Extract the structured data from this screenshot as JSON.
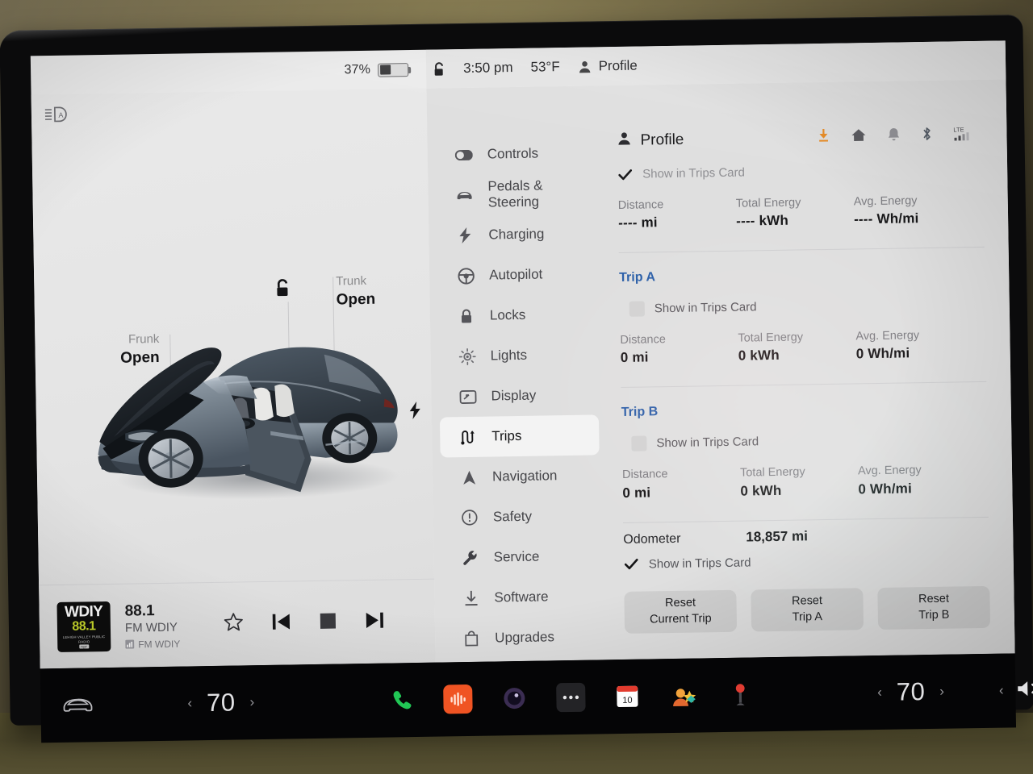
{
  "status_bar": {
    "battery_percent": "37%",
    "battery_level": 37,
    "lock_icon": "unlocked-padlock-icon",
    "time": "3:50 pm",
    "temperature": "53°F",
    "profile_label": "Profile"
  },
  "car_view": {
    "auto_headlight_icon": "auto-headlight-icon",
    "frunk": {
      "label": "Frunk",
      "state": "Open"
    },
    "trunk": {
      "label": "Trunk",
      "state": "Open"
    },
    "lock_icon": "unlocked-padlock-icon",
    "charge_port_icon": "charge-bolt-icon"
  },
  "media_player": {
    "art_primary": "WDIY",
    "art_secondary": "88.1",
    "art_tagline": "LEHIGH VALLEY PUBLIC RADIO",
    "art_badge": "npr",
    "frequency": "88.1",
    "station": "FM WDIY",
    "source": "FM WDIY",
    "controls": {
      "favorite": "star-icon",
      "previous": "previous-track-icon",
      "stop": "stop-icon",
      "next": "next-track-icon"
    }
  },
  "settings_menu": {
    "items": [
      {
        "label": "Controls",
        "icon": "toggle-switch-icon",
        "active": false
      },
      {
        "label": "Pedals & Steering",
        "icon": "car-front-icon",
        "active": false
      },
      {
        "label": "Charging",
        "icon": "lightning-bolt-icon",
        "active": false
      },
      {
        "label": "Autopilot",
        "icon": "steering-wheel-icon",
        "active": false
      },
      {
        "label": "Locks",
        "icon": "padlock-icon",
        "active": false
      },
      {
        "label": "Lights",
        "icon": "light-bulb-icon",
        "active": false
      },
      {
        "label": "Display",
        "icon": "display-icon",
        "active": false
      },
      {
        "label": "Trips",
        "icon": "route-icon",
        "active": true
      },
      {
        "label": "Navigation",
        "icon": "navigation-arrow-icon",
        "active": false
      },
      {
        "label": "Safety",
        "icon": "alert-circle-icon",
        "active": false
      },
      {
        "label": "Service",
        "icon": "wrench-icon",
        "active": false
      },
      {
        "label": "Software",
        "icon": "download-icon",
        "active": false
      },
      {
        "label": "Upgrades",
        "icon": "shopping-bag-icon",
        "active": false
      }
    ]
  },
  "trips_panel": {
    "header": {
      "title": "Profile",
      "icon": "person-icon"
    },
    "status_icons": [
      "download-icon",
      "home-icon",
      "bell-icon",
      "bluetooth-icon",
      "lte-signal-icon"
    ],
    "lte_label": "LTE",
    "notification_download_icon": "download-arrow-icon",
    "checkbox_label": "Show in Trips Card",
    "stat_labels": {
      "distance": "Distance",
      "total_energy": "Total Energy",
      "avg_energy": "Avg. Energy"
    },
    "units": {
      "distance": "mi",
      "total_energy": "kWh",
      "avg_energy": "Wh/mi"
    },
    "current_trip": {
      "show_in_trips_card": true,
      "checkbox_enabled": false,
      "distance": "----",
      "total_energy": "----",
      "avg_energy": "----"
    },
    "trip_a": {
      "title": "Trip A",
      "show_in_trips_card": false,
      "distance": "0",
      "total_energy": "0",
      "avg_energy": "0"
    },
    "trip_b": {
      "title": "Trip B",
      "show_in_trips_card": false,
      "distance": "0",
      "total_energy": "0",
      "avg_energy": "0"
    },
    "odometer": {
      "label": "Odometer",
      "value": "18,857",
      "unit": "mi",
      "show_in_trips_card": true
    },
    "buttons": [
      {
        "line1": "Reset",
        "line2": "Current Trip"
      },
      {
        "line1": "Reset",
        "line2": "Trip A"
      },
      {
        "line1": "Reset",
        "line2": "Trip B"
      }
    ]
  },
  "app_bar": {
    "car_icon": "car-icon",
    "driver_temp": "70",
    "passenger_temp": "70",
    "apps": [
      {
        "name": "phone-icon",
        "color": "#21c755"
      },
      {
        "name": "media-icon",
        "color": "#f05423"
      },
      {
        "name": "camera-icon",
        "color": "#3b2d52"
      },
      {
        "name": "more-icon",
        "color": "#3a3a3c"
      },
      {
        "name": "calendar-icon",
        "color": "#ffffff",
        "day": "10"
      },
      {
        "name": "contacts-icon",
        "color": "#f2a33c"
      },
      {
        "name": "arcade-icon",
        "color": "#d8443c"
      }
    ],
    "mute_icon": "mute-icon",
    "mute_mark": "×"
  },
  "colors": {
    "accent_blue": "#2a5fa8",
    "accent_orange": "#e8891f",
    "screen_bg": "#ebebeb",
    "sheet_bg": "#dfdfdf",
    "appbar_bg": "#050506"
  }
}
